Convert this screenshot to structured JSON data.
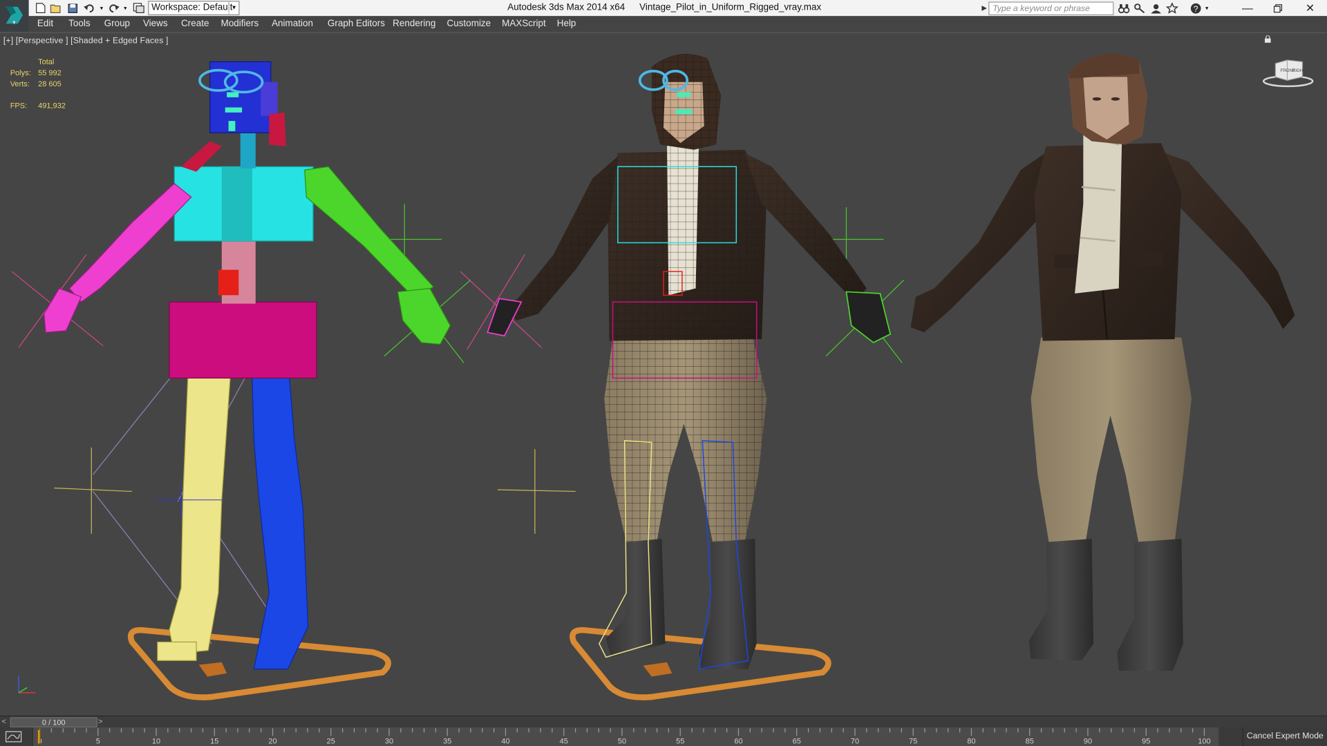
{
  "titlebar": {
    "app_name": "Autodesk 3ds Max  2014 x64",
    "file_name": "Vintage_Pilot_in_Uniform_Rigged_vray.max",
    "workspace_label": "Workspace: Default",
    "search_placeholder": "Type a keyword or phrase",
    "quick_access_icons": [
      "new-file-icon",
      "open-file-icon",
      "save-icon",
      "undo-icon",
      "redo-icon",
      "project-folder-icon"
    ],
    "help_icons": [
      "binoculars-icon",
      "key-icon",
      "user-icon",
      "star-icon",
      "help-icon"
    ],
    "window_controls": [
      "minimize",
      "restore",
      "close"
    ]
  },
  "menu": {
    "items": [
      "Edit",
      "Tools",
      "Group",
      "Views",
      "Create",
      "Modifiers",
      "Animation",
      "Graph Editors",
      "Rendering",
      "Customize",
      "MAXScript",
      "Help"
    ]
  },
  "viewport": {
    "label": "[+] [Perspective ] [Shaded + Edged Faces ]",
    "stats": {
      "header": "Total",
      "polys_label": "Polys:",
      "polys_value": "55 992",
      "verts_label": "Verts:",
      "verts_value": "28 605",
      "fps_label": "FPS:",
      "fps_value": "491,932"
    },
    "viewcube_faces": [
      "FRONT",
      "RIGHT"
    ]
  },
  "timeline": {
    "slider_label": "0 / 100",
    "current_frame": 0,
    "start": 0,
    "end": 100,
    "ticks": [
      "0",
      "5",
      "10",
      "15",
      "20",
      "25",
      "30",
      "35",
      "40",
      "45",
      "50",
      "55",
      "60",
      "65",
      "70",
      "75",
      "80",
      "85",
      "90",
      "95",
      "100"
    ]
  },
  "statusbar": {
    "cancel_expert": "Cancel Expert Mode"
  }
}
